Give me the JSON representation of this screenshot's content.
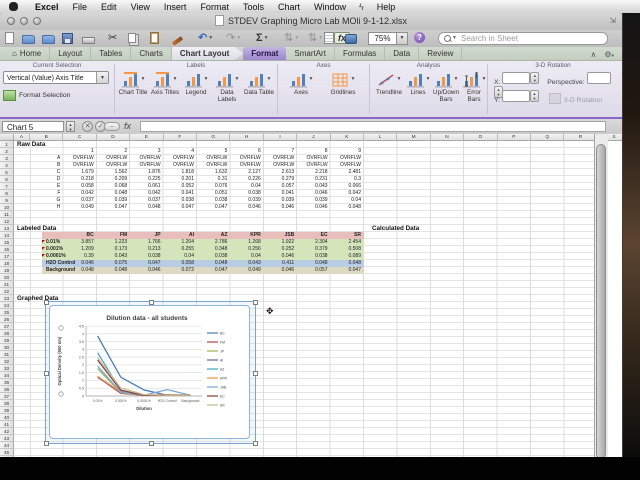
{
  "menu_bar": {
    "items": [
      "Excel",
      "File",
      "Edit",
      "View",
      "Insert",
      "Format",
      "Tools",
      "Chart",
      "Window",
      "Help"
    ]
  },
  "window": {
    "title": "STDEV Graphing Micro Lab MOli 9-1-12.xlsx",
    "traffic_light_icons": [
      "close-icon",
      "minimize-icon",
      "zoom-icon"
    ]
  },
  "toolbar": {
    "icons": [
      "new",
      "open",
      "import",
      "save",
      "print",
      "cut",
      "copy",
      "paste",
      "format-painter",
      "undo",
      "redo",
      "autosum",
      "sort-ascending",
      "sort-descending",
      "formula-builder",
      "notebook",
      "toolbox"
    ],
    "zoom_value": "75%",
    "help_label": "?",
    "search_placeholder": "Search in Sheet"
  },
  "ribbon_tabs": [
    {
      "label": "Home",
      "style": "normal",
      "icon": "home"
    },
    {
      "label": "Layout",
      "style": "normal"
    },
    {
      "label": "Tables",
      "style": "normal"
    },
    {
      "label": "Charts",
      "style": "normal"
    },
    {
      "label": "Chart Layout",
      "style": "contextual"
    },
    {
      "label": "Format",
      "style": "selected"
    },
    {
      "label": "SmartArt",
      "style": "normal"
    },
    {
      "label": "Formulas",
      "style": "normal"
    },
    {
      "label": "Data",
      "style": "normal"
    },
    {
      "label": "Review",
      "style": "normal"
    }
  ],
  "ribbon": {
    "current_selection": {
      "title": "Current Selection",
      "dropdown_value": "Vertical (Value) Axis Title",
      "format_selection": "Format Selection"
    },
    "labels": {
      "title": "Labels",
      "chart_title": "Chart Title",
      "axis_titles": "Axis Titles",
      "legend": "Legend",
      "data_labels": "Data Labels",
      "data_table": "Data Table"
    },
    "axes": {
      "title": "Axes",
      "axes": "Axes",
      "gridlines": "Gridlines"
    },
    "analysis": {
      "title": "Analysis",
      "trendline": "Trendline",
      "lines": "Lines",
      "updown": "Up/Down Bars",
      "error_bars": "Error Bars"
    },
    "rotation": {
      "title": "3-D Rotation",
      "x": "X:",
      "y": "Y:",
      "perspective": "Perspective:",
      "button": "3-D Rotation"
    }
  },
  "formula_bar": {
    "name_box": "Chart 5"
  },
  "sheet": {
    "columns": [
      "A",
      "B",
      "C",
      "D",
      "E",
      "F",
      "G",
      "H",
      "I",
      "J",
      "K",
      "L",
      "M",
      "N",
      "O",
      "P",
      "Q",
      "R",
      "S"
    ],
    "visible_row_count": 47,
    "raw_data": {
      "title": "Raw Data",
      "col_numbers": [
        "1",
        "2",
        "3",
        "4",
        "5",
        "6",
        "7",
        "8",
        "9"
      ],
      "rows": [
        {
          "label": "A",
          "values": [
            "OVRFLW",
            "OVRFLW",
            "OVRFLW",
            "OVRFLW",
            "OVRFLW",
            "OVRFLW",
            "OVRFLW",
            "OVRFLW",
            "OVRFLW"
          ]
        },
        {
          "label": "B",
          "values": [
            "OVRFLW",
            "OVRFLW",
            "OVRFLW",
            "OVRFLW",
            "OVRFLW",
            "OVRFLW",
            "OVRFLW",
            "OVRFLW",
            "OVRFLW"
          ]
        },
        {
          "label": "C",
          "values": [
            "1.679",
            "1.562",
            "1.876",
            "1.818",
            "1.632",
            "2.127",
            "2.613",
            "2.218",
            "2.481"
          ]
        },
        {
          "label": "D",
          "values": [
            "0.218",
            "0.209",
            "0.225",
            "0.201",
            "0.31",
            "0.226",
            "0.279",
            "0.231",
            "0.3"
          ]
        },
        {
          "label": "E",
          "values": [
            "0.058",
            "0.068",
            "0.061",
            "0.052",
            "0.076",
            "0.04",
            "0.057",
            "0.043",
            "0.066"
          ]
        },
        {
          "label": "F",
          "values": [
            "0.042",
            "0.048",
            "0.042",
            "0.041",
            "0.051",
            "0.038",
            "0.041",
            "0.046",
            "0.042"
          ]
        },
        {
          "label": "G",
          "values": [
            "0.037",
            "0.039",
            "0.037",
            "0.038",
            "0.038",
            "0.039",
            "0.039",
            "0.039",
            "0.04"
          ]
        },
        {
          "label": "H",
          "values": [
            "0.049",
            "0.047",
            "0.048",
            "0.047",
            "0.047",
            "0.046",
            "0.046",
            "0.046",
            "0.048"
          ]
        }
      ]
    },
    "labeled_data": {
      "title": "Labeled Data",
      "headers": [
        "BC",
        "FM",
        "JP",
        "AI",
        "AZ",
        "KPR",
        "JSB",
        "EC",
        "SR"
      ],
      "header_bg": "#e8bebc",
      "rows": [
        {
          "label": "0.01%",
          "bg": "#d6e4bc",
          "comment": true,
          "values": [
            "3.857",
            "1.223",
            "1.766",
            "1.204",
            "2.786",
            "1.268",
            "1.922",
            "2.304",
            "2.454"
          ]
        },
        {
          "label": "0.001%",
          "bg": "#d6e4bc",
          "comment": true,
          "values": [
            "1.209",
            "0.173",
            "0.213",
            "0.255",
            "0.348",
            "0.256",
            "0.252",
            "0.379",
            "0.508"
          ]
        },
        {
          "label": "0.0001%",
          "bg": "#d6e4bc",
          "comment": true,
          "values": [
            "0.39",
            "0.043",
            "0.038",
            "0.04",
            "0.038",
            "0.04",
            "0.046",
            "0.038",
            "0.089"
          ]
        },
        {
          "label": "H2O Control",
          "bg": "#b8cce4",
          "comment": false,
          "values": [
            "0.046",
            "0.075",
            "0.047",
            "0.058",
            "0.048",
            "0.043",
            "0.411",
            "0.048",
            "0.048"
          ]
        },
        {
          "label": "Background",
          "bg": "#ddd9c3",
          "comment": false,
          "values": [
            "0.048",
            "0.048",
            "0.046",
            "0.072",
            "0.047",
            "0.049",
            "0.046",
            "0.057",
            "0.047"
          ]
        }
      ]
    },
    "calculated_data_title": "Calculated Data",
    "graphed_data_title": "Graphed Data"
  },
  "chart_data": {
    "type": "line",
    "title": "Dilution data - all students",
    "xlabel": "Dilution",
    "ylabel": "Optical Density (600 nm)",
    "categories": [
      "0.01%",
      "0.001%",
      "0.0001%",
      "H2O Control",
      "Background"
    ],
    "series": [
      {
        "name": "BC",
        "color": "#4a7ebb",
        "values": [
          3.857,
          1.209,
          0.39,
          0.046,
          0.048
        ]
      },
      {
        "name": "FM",
        "color": "#be4b48",
        "values": [
          1.223,
          0.173,
          0.043,
          0.075,
          0.048
        ]
      },
      {
        "name": "JP",
        "color": "#98b954",
        "values": [
          1.766,
          0.213,
          0.038,
          0.047,
          0.046
        ]
      },
      {
        "name": "AI",
        "color": "#7d60a0",
        "values": [
          1.204,
          0.255,
          0.04,
          0.058,
          0.072
        ]
      },
      {
        "name": "AZ",
        "color": "#46aac5",
        "values": [
          2.786,
          0.348,
          0.038,
          0.048,
          0.047
        ]
      },
      {
        "name": "KPR",
        "color": "#f69646",
        "values": [
          1.268,
          0.256,
          0.04,
          0.043,
          0.049
        ]
      },
      {
        "name": "JSB",
        "color": "#7da7d8",
        "values": [
          1.922,
          0.252,
          0.046,
          0.411,
          0.046
        ]
      },
      {
        "name": "EC",
        "color": "#8c3f3c",
        "values": [
          2.304,
          0.379,
          0.038,
          0.048,
          0.057
        ]
      },
      {
        "name": "SR",
        "color": "#c8bd8f",
        "values": [
          2.454,
          0.508,
          0.089,
          0.048,
          0.047
        ]
      }
    ],
    "ylim": [
      0,
      4.5
    ],
    "ytick_step": 0.5,
    "grid": true,
    "legend_position": "right"
  }
}
